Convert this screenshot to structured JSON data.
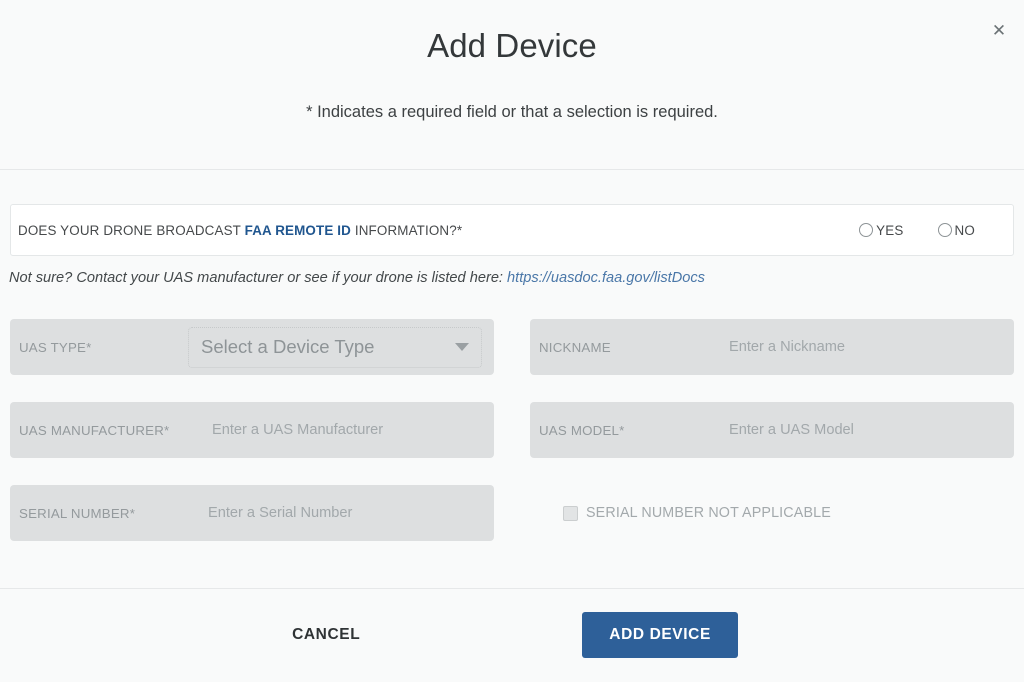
{
  "modal": {
    "title": "Add Device",
    "required_note": "* Indicates a required field or that a selection is required.",
    "close_icon": "close-icon",
    "close_glyph": "✕"
  },
  "remote_id": {
    "question_prefix": "DOES YOUR DRONE BROADCAST ",
    "question_highlight": "FAA REMOTE ID",
    "question_suffix": " INFORMATION?*",
    "options": [
      {
        "label": "YES",
        "value": "yes",
        "selected": false
      },
      {
        "label": "NO",
        "value": "no",
        "selected": false
      }
    ],
    "help_text": "Not sure? Contact your UAS manufacturer or see if your drone is listed here: ",
    "help_link_text": "https://uasdoc.faa.gov/listDocs"
  },
  "form": {
    "uas_type": {
      "label": "UAS TYPE*",
      "select_value": "Select a Device Type",
      "caret_icon": "chevron-down-icon"
    },
    "nickname": {
      "label": "NICKNAME",
      "placeholder": "Enter a Nickname",
      "value": ""
    },
    "uas_manufacturer": {
      "label": "UAS MANUFACTURER*",
      "placeholder": "Enter a UAS Manufacturer",
      "value": ""
    },
    "uas_model": {
      "label": "UAS MODEL*",
      "placeholder": "Enter a UAS Model",
      "value": ""
    },
    "serial_number": {
      "label": "SERIAL NUMBER*",
      "placeholder": "Enter a Serial Number",
      "value": ""
    },
    "serial_not_applicable": {
      "label": "SERIAL NUMBER NOT APPLICABLE",
      "checked": false
    }
  },
  "footer": {
    "cancel_label": "CANCEL",
    "submit_label": "ADD DEVICE"
  },
  "colors": {
    "primary_blue": "#2e6099",
    "link_blue": "#4a77a8",
    "highlight_blue": "#20568f",
    "field_bg": "#dddfe0",
    "page_bg": "#f9fafa"
  }
}
